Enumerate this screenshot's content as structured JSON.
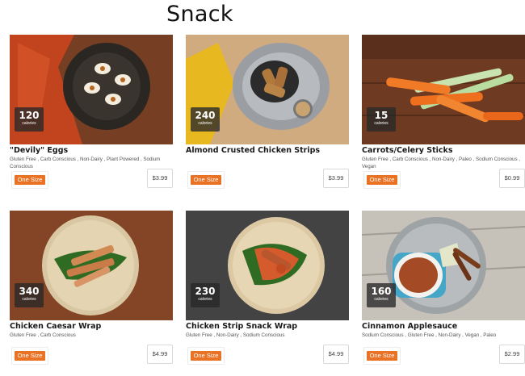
{
  "page": {
    "title": "Snack"
  },
  "items": [
    {
      "name": "\"Devily\" Eggs",
      "calories": "120",
      "calories_unit": "calories",
      "tags": "Gluten Free ,  Carb Conscious ,  Non-Dairy ,  Plant Powered ,  Sodium Conscious",
      "size": "One Size",
      "price": "$3.99"
    },
    {
      "name": "Almond Crusted Chicken Strips",
      "calories": "240",
      "calories_unit": "calories",
      "tags": "",
      "size": "One Size",
      "price": "$3.99"
    },
    {
      "name": "Carrots/Celery Sticks",
      "calories": "15",
      "calories_unit": "calories",
      "tags": "Gluten Free ,  Carb Conscious ,  Non-Dairy ,  Paleo ,  Sodium Conscious ,  Vegan",
      "size": "One Size",
      "price": "$0.99"
    },
    {
      "name": "Chicken Caesar Wrap",
      "calories": "340",
      "calories_unit": "calories",
      "tags": "Gluten Free ,  Carb Conscious",
      "size": "One Size",
      "price": "$4.99"
    },
    {
      "name": "Chicken Strip Snack Wrap",
      "calories": "230",
      "calories_unit": "calories",
      "tags": "Gluten Free ,  Non-Dairy ,  Sodium Conscious",
      "size": "One Size",
      "price": "$4.99"
    },
    {
      "name": "Cinnamon Applesauce",
      "calories": "160",
      "calories_unit": "calories",
      "tags": "Sodium Conscious ,  Gluten Free ,  Non-Dairy ,  Vegan ,  Paleo",
      "size": "One Size",
      "price": "$2.99"
    }
  ],
  "colors": {
    "accent": "#ea7224",
    "badge": "#2a2a2a"
  }
}
